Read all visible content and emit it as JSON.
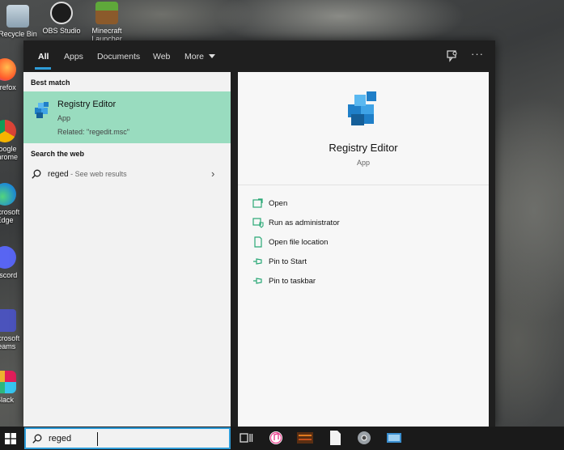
{
  "desktop": {
    "icons": [
      {
        "label": "Recycle Bin"
      },
      {
        "label": "OBS Studio"
      },
      {
        "label": "Minecraft Launcher"
      },
      {
        "label": "Firefox"
      },
      {
        "label": "Google Chrome"
      },
      {
        "label": "Microsoft Edge"
      },
      {
        "label": "Discord"
      },
      {
        "label": "Microsoft Teams"
      },
      {
        "label": "Slack"
      }
    ]
  },
  "tabs": [
    {
      "label": "All"
    },
    {
      "label": "Apps"
    },
    {
      "label": "Documents"
    },
    {
      "label": "Web"
    },
    {
      "label": "More"
    }
  ],
  "results": {
    "best_match_heading": "Best match",
    "best_match": {
      "title": "Registry Editor",
      "subtitle": "App",
      "related": "Related: \"regedit.msc\""
    },
    "web_heading": "Search the web",
    "web_query": "reged",
    "web_suffix": " - See web results"
  },
  "preview": {
    "title": "Registry Editor",
    "subtitle": "App",
    "actions": [
      {
        "label": "Open"
      },
      {
        "label": "Run as administrator"
      },
      {
        "label": "Open file location"
      },
      {
        "label": "Pin to Start"
      },
      {
        "label": "Pin to taskbar"
      }
    ]
  },
  "taskbar": {
    "search_value": "reged"
  },
  "colors": {
    "accent": "#2e9cd8",
    "selected_result": "#99dcbf",
    "action_icon": "#2aa876"
  }
}
